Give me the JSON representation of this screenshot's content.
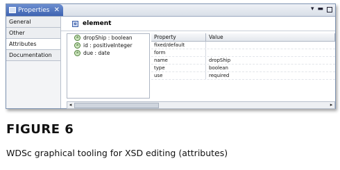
{
  "window": {
    "tab_label": "Properties",
    "tab_close": "✕",
    "controls": {
      "menu": "▾",
      "minimize": "▬"
    }
  },
  "left_tabs": [
    {
      "label": "General",
      "selected": false
    },
    {
      "label": "Other",
      "selected": false
    },
    {
      "label": "Attributes",
      "selected": true
    },
    {
      "label": "Documentation",
      "selected": false
    }
  ],
  "element": {
    "icon": "e",
    "label": "element"
  },
  "attributes": [
    {
      "icon": "a",
      "label": "dropShip : boolean"
    },
    {
      "icon": "a",
      "label": "id : positiveInteger"
    },
    {
      "icon": "a",
      "label": "due : date"
    }
  ],
  "properties": {
    "headers": {
      "property": "Property",
      "value": "Value"
    },
    "rows": [
      {
        "property": "fixed/default",
        "value": ""
      },
      {
        "property": "form",
        "value": ""
      },
      {
        "property": "name",
        "value": "dropShip"
      },
      {
        "property": "type",
        "value": "boolean"
      },
      {
        "property": "use",
        "value": "required"
      }
    ]
  },
  "scrollbar": {
    "left_arrow": "◂",
    "right_arrow": "▸"
  },
  "figure": {
    "title": "FIGURE 6",
    "caption": "WDSc graphical tooling for XSD editing (attributes)"
  }
}
